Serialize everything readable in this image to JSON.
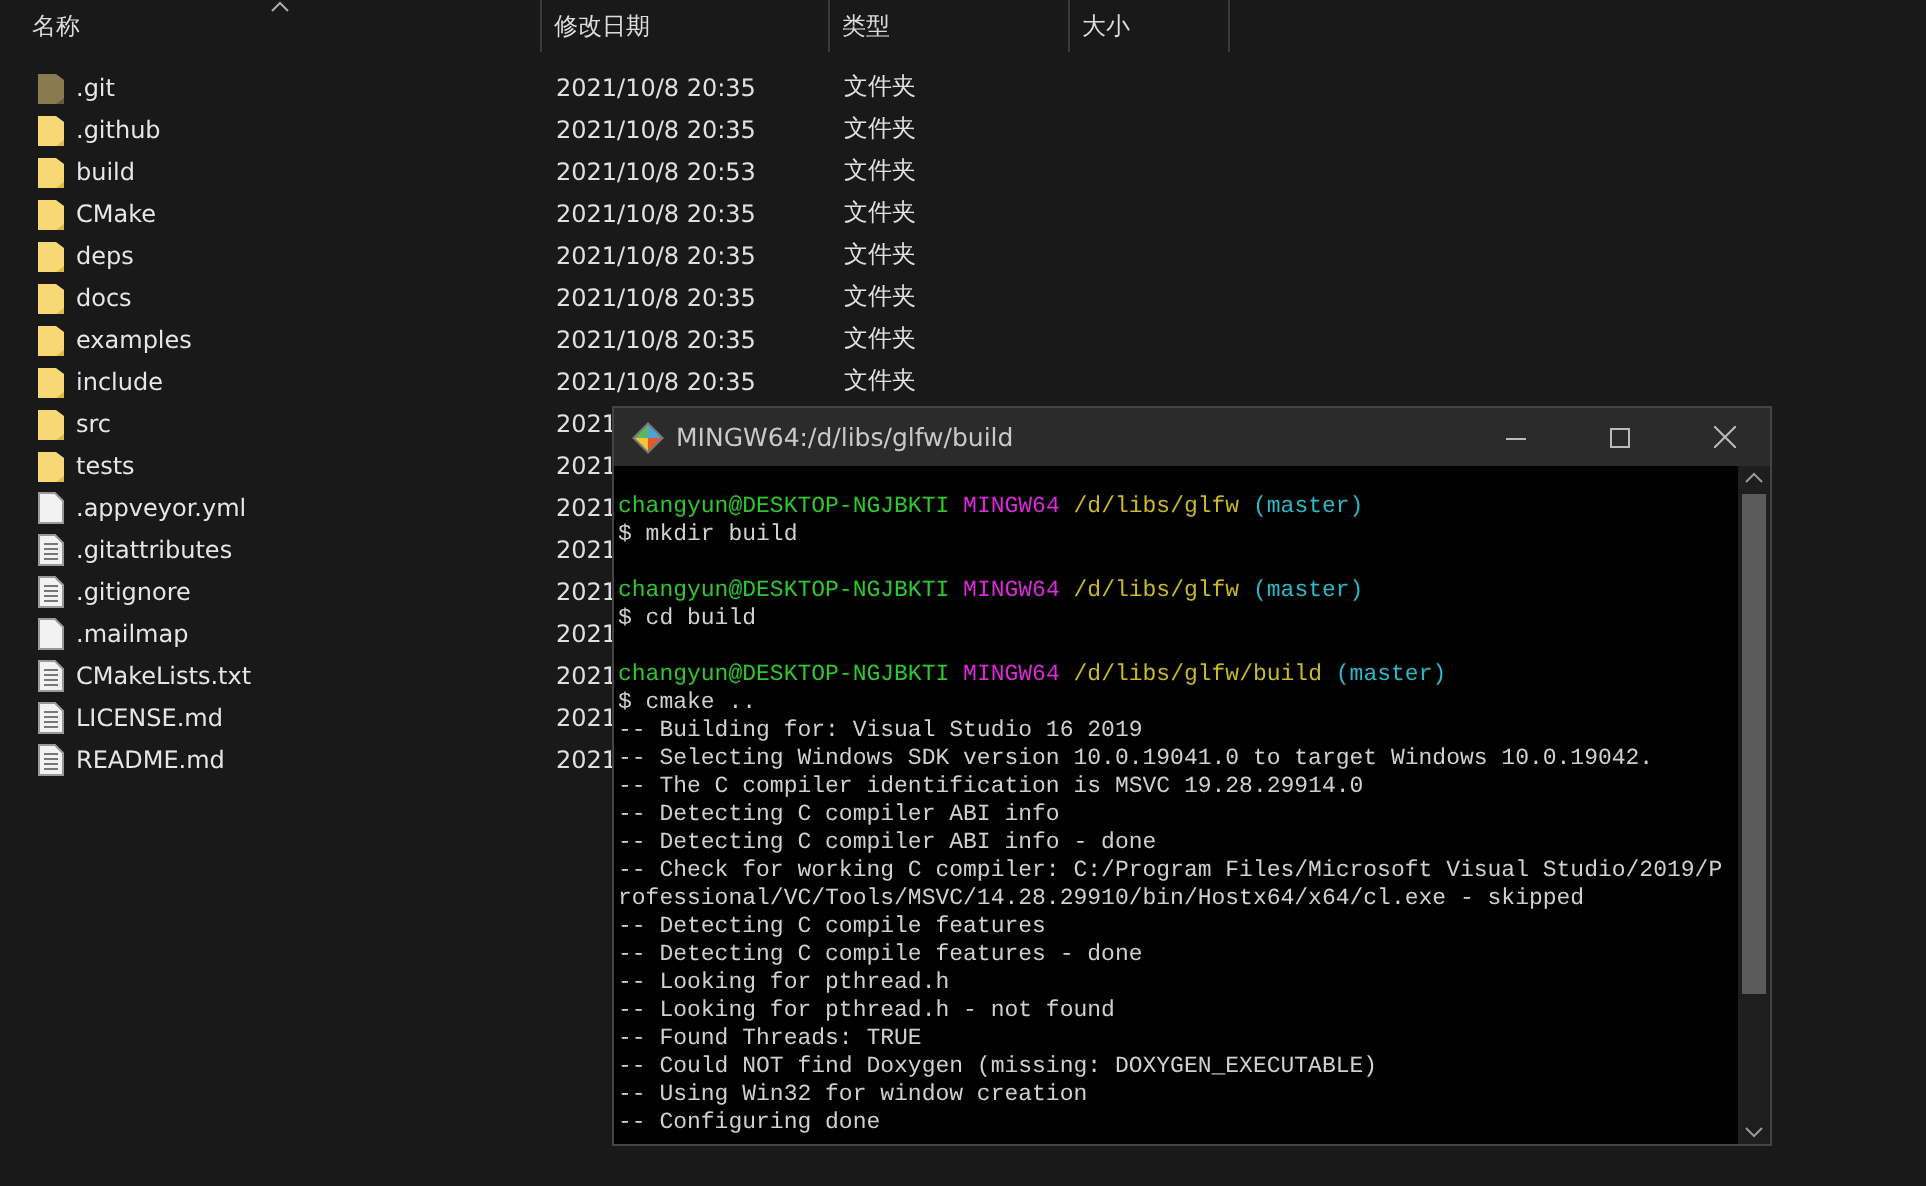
{
  "explorer": {
    "columns": [
      {
        "label": "名称",
        "sorted": true
      },
      {
        "label": "修改日期",
        "sorted": false
      },
      {
        "label": "类型",
        "sorted": false
      },
      {
        "label": "大小",
        "sorted": false
      }
    ],
    "rows": [
      {
        "kind": "folder-hidden",
        "name": ".git",
        "date": "2021/10/8 20:35",
        "type": "文件夹"
      },
      {
        "kind": "folder",
        "name": ".github",
        "date": "2021/10/8 20:35",
        "type": "文件夹"
      },
      {
        "kind": "folder",
        "name": "build",
        "date": "2021/10/8 20:53",
        "type": "文件夹"
      },
      {
        "kind": "folder",
        "name": "CMake",
        "date": "2021/10/8 20:35",
        "type": "文件夹"
      },
      {
        "kind": "folder",
        "name": "deps",
        "date": "2021/10/8 20:35",
        "type": "文件夹"
      },
      {
        "kind": "folder",
        "name": "docs",
        "date": "2021/10/8 20:35",
        "type": "文件夹"
      },
      {
        "kind": "folder",
        "name": "examples",
        "date": "2021/10/8 20:35",
        "type": "文件夹"
      },
      {
        "kind": "folder",
        "name": "include",
        "date": "2021/10/8 20:35",
        "type": "文件夹"
      },
      {
        "kind": "folder",
        "name": "src",
        "date": "2021"
      },
      {
        "kind": "folder",
        "name": "tests",
        "date": "2021"
      },
      {
        "kind": "file",
        "name": ".appveyor.yml",
        "date": "2021"
      },
      {
        "kind": "text-file",
        "name": ".gitattributes",
        "date": "2021"
      },
      {
        "kind": "text-file",
        "name": ".gitignore",
        "date": "2021"
      },
      {
        "kind": "file",
        "name": ".mailmap",
        "date": "2021"
      },
      {
        "kind": "text-file",
        "name": "CMakeLists.txt",
        "date": "2021"
      },
      {
        "kind": "text-file",
        "name": "LICENSE.md",
        "date": "2021"
      },
      {
        "kind": "text-file",
        "name": "README.md",
        "date": "2021"
      }
    ]
  },
  "terminal": {
    "title": "MINGW64:/d/libs/glfw/build",
    "lines": [
      {
        "kind": "prompt",
        "user": "changyun@DESKTOP-NGJBKTI",
        "system": "MINGW64",
        "path": "/d/libs/glfw",
        "branch": "(master)"
      },
      {
        "kind": "output",
        "text": "$ mkdir build"
      },
      {
        "kind": "prompt",
        "user": "changyun@DESKTOP-NGJBKTI",
        "system": "MINGW64",
        "path": "/d/libs/glfw",
        "branch": "(master)"
      },
      {
        "kind": "output",
        "text": "$ cd build"
      },
      {
        "kind": "prompt",
        "user": "changyun@DESKTOP-NGJBKTI",
        "system": "MINGW64",
        "path": "/d/libs/glfw/build",
        "branch": "(master)"
      },
      {
        "kind": "output",
        "text": "$ cmake .."
      },
      {
        "kind": "output",
        "text": "-- Building for: Visual Studio 16 2019"
      },
      {
        "kind": "output",
        "text": "-- Selecting Windows SDK version 10.0.19041.0 to target Windows 10.0.19042."
      },
      {
        "kind": "output",
        "text": "-- The C compiler identification is MSVC 19.28.29914.0"
      },
      {
        "kind": "output",
        "text": "-- Detecting C compiler ABI info"
      },
      {
        "kind": "output",
        "text": "-- Detecting C compiler ABI info - done"
      },
      {
        "kind": "output",
        "text": "-- Check for working C compiler: C:/Program Files/Microsoft Visual Studio/2019/P"
      },
      {
        "kind": "output",
        "text": "rofessional/VC/Tools/MSVC/14.28.29910/bin/Hostx64/x64/cl.exe - skipped"
      },
      {
        "kind": "output",
        "text": "-- Detecting C compile features"
      },
      {
        "kind": "output",
        "text": "-- Detecting C compile features - done"
      },
      {
        "kind": "output",
        "text": "-- Looking for pthread.h"
      },
      {
        "kind": "output",
        "text": "-- Looking for pthread.h - not found"
      },
      {
        "kind": "output",
        "text": "-- Found Threads: TRUE"
      },
      {
        "kind": "output",
        "text": "-- Could NOT find Doxygen (missing: DOXYGEN_EXECUTABLE)"
      },
      {
        "kind": "output",
        "text": "-- Using Win32 for window creation"
      },
      {
        "kind": "output",
        "text": "-- Configuring done"
      }
    ]
  }
}
